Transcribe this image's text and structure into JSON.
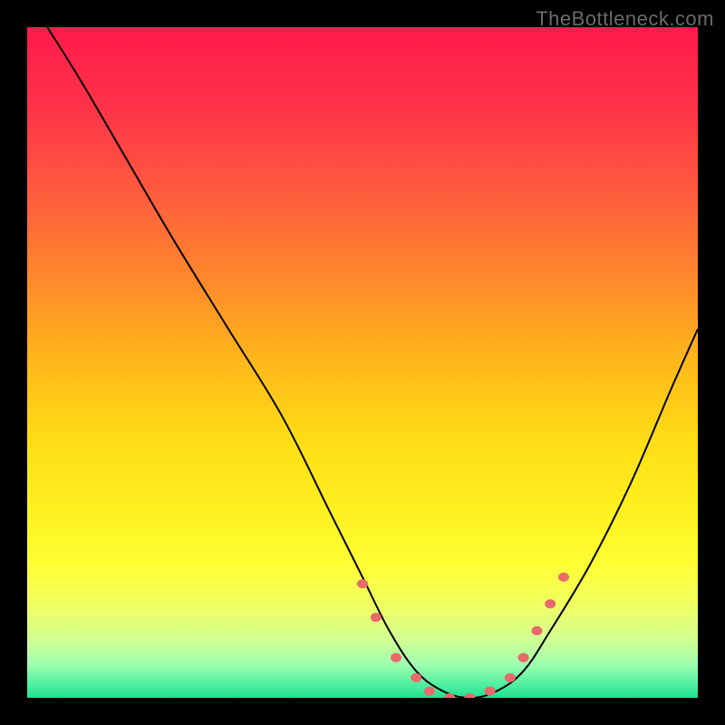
{
  "watermark": "TheBottleneck.com",
  "chart_data": {
    "type": "line",
    "title": "",
    "xlabel": "",
    "ylabel": "",
    "xlim": [
      0,
      100
    ],
    "ylim": [
      0,
      100
    ],
    "grid": false,
    "legend": false,
    "background_gradient": {
      "stops": [
        {
          "offset": 0.0,
          "color": "#ff1a4a"
        },
        {
          "offset": 0.12,
          "color": "#ff3348"
        },
        {
          "offset": 0.25,
          "color": "#ff5c3d"
        },
        {
          "offset": 0.38,
          "color": "#ff8a2a"
        },
        {
          "offset": 0.5,
          "color": "#ffb81a"
        },
        {
          "offset": 0.62,
          "color": "#ffde15"
        },
        {
          "offset": 0.72,
          "color": "#fff020"
        },
        {
          "offset": 0.8,
          "color": "#ffff33"
        },
        {
          "offset": 0.86,
          "color": "#f0ff60"
        },
        {
          "offset": 0.91,
          "color": "#d5ff90"
        },
        {
          "offset": 0.95,
          "color": "#a0ffb0"
        },
        {
          "offset": 0.98,
          "color": "#50f0a0"
        },
        {
          "offset": 1.0,
          "color": "#20e090"
        }
      ]
    },
    "series": [
      {
        "name": "bottleneck-curve",
        "x": [
          3,
          8,
          15,
          22,
          30,
          38,
          45,
          50,
          54,
          58,
          62,
          66,
          70,
          74,
          78,
          84,
          90,
          96,
          100
        ],
        "y": [
          100,
          92,
          80,
          68,
          55,
          42,
          28,
          18,
          10,
          4,
          1,
          0,
          1,
          4,
          10,
          20,
          32,
          46,
          55
        ],
        "color": "#000000",
        "width": 2
      }
    ],
    "markers": {
      "name": "highlight-dots",
      "x": [
        50,
        52,
        55,
        58,
        60,
        63,
        66,
        69,
        72,
        74,
        76,
        78,
        80
      ],
      "y": [
        17,
        12,
        6,
        3,
        1,
        0,
        0,
        1,
        3,
        6,
        10,
        14,
        18
      ],
      "color": "#e86a6a",
      "size": 6
    }
  }
}
